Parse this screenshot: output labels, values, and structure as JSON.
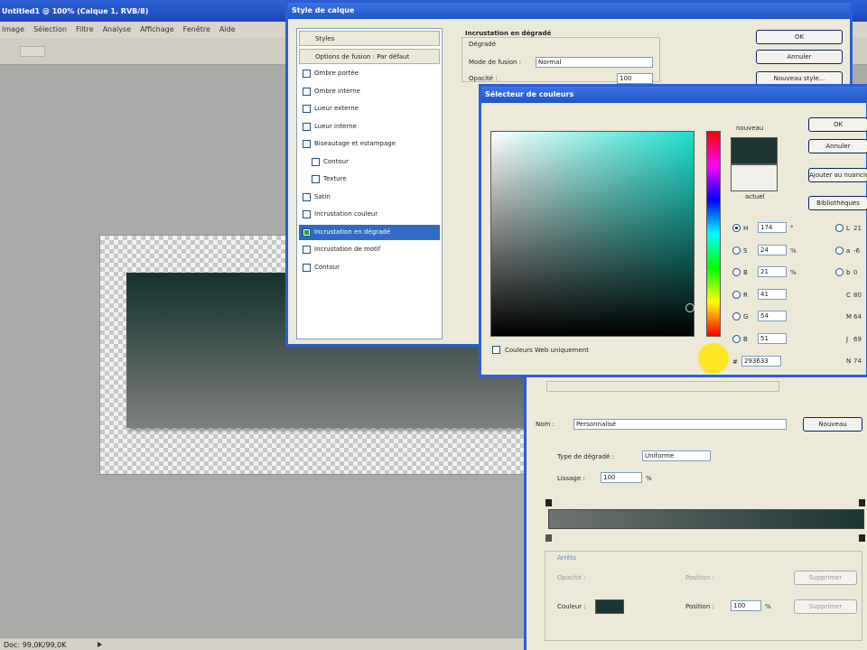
{
  "app": {
    "title": "Untitled1 @ 100% (Calque 1, RVB/8)",
    "menus": [
      "Image",
      "Sélection",
      "Filtre",
      "Analyse",
      "Affichage",
      "Fenêtre",
      "Aide"
    ],
    "status_text": "Doc: 99,0K/99,0K"
  },
  "layer_style": {
    "title": "Style de calque",
    "styles_header": "Styles",
    "blend_options": "Options de fusion : Par défaut",
    "items": [
      {
        "label": "Ombre portée",
        "checked": false
      },
      {
        "label": "Ombre interne",
        "checked": false
      },
      {
        "label": "Lueur externe",
        "checked": false
      },
      {
        "label": "Lueur interne",
        "checked": false
      },
      {
        "label": "Biseautage et estampage",
        "checked": false
      },
      {
        "label": "Contour",
        "checked": false
      },
      {
        "label": "Texture",
        "checked": false
      },
      {
        "label": "Satin",
        "checked": false
      },
      {
        "label": "Incrustation couleur",
        "checked": false
      },
      {
        "label": "Incrustation en dégradé",
        "checked": true,
        "selected": true
      },
      {
        "label": "Incrustation de motif",
        "checked": false
      },
      {
        "label": "Contour",
        "checked": false
      }
    ],
    "section_title": "Incrustation en dégradé",
    "group_title": "Dégradé",
    "blend_mode_label": "Mode de fusion :",
    "blend_mode_value": "Normal",
    "opacity_label": "Opacité :",
    "opacity_value": "100",
    "buttons": {
      "ok": "OK",
      "cancel": "Annuler",
      "new_style": "Nouveau style..."
    }
  },
  "color_picker": {
    "title": "Sélecteur de couleurs",
    "new_label": "nouveau",
    "current_label": "actuel",
    "new_color": "#1c3532",
    "current_color": "#f0f0ea",
    "buttons": {
      "ok": "OK",
      "cancel": "Annuler",
      "add_swatch": "Ajouter au nuancier",
      "libraries": "Bibliothèques"
    },
    "hsb": {
      "h": "174",
      "s": "24",
      "b": "21"
    },
    "rgb": {
      "r": "41",
      "g": "54",
      "b": "51"
    },
    "lab": {
      "l": "21",
      "a": "-6",
      "b": "0"
    },
    "cmyk": {
      "c": "80",
      "m": "64",
      "y": "69",
      "k": "74"
    },
    "hex": "293633",
    "web_only_label": "Couleurs Web uniquement"
  },
  "gradient_editor": {
    "name_label": "Nom :",
    "name_value": "Personnalisé",
    "new_button": "Nouveau",
    "type_label": "Type de dégradé :",
    "type_value": "Uniforme",
    "smoothness_label": "Lissage :",
    "smoothness_value": "100",
    "stops_title": "Arrêts",
    "opacity_label": "Opacité :",
    "location_label": "Position :",
    "delete_label": "Supprimer",
    "color_label": "Couleur :",
    "color_location_value": "100",
    "stop_color": "#1c3532",
    "gradient_start": "#6f7472",
    "gradient_end": "#1c3532"
  }
}
